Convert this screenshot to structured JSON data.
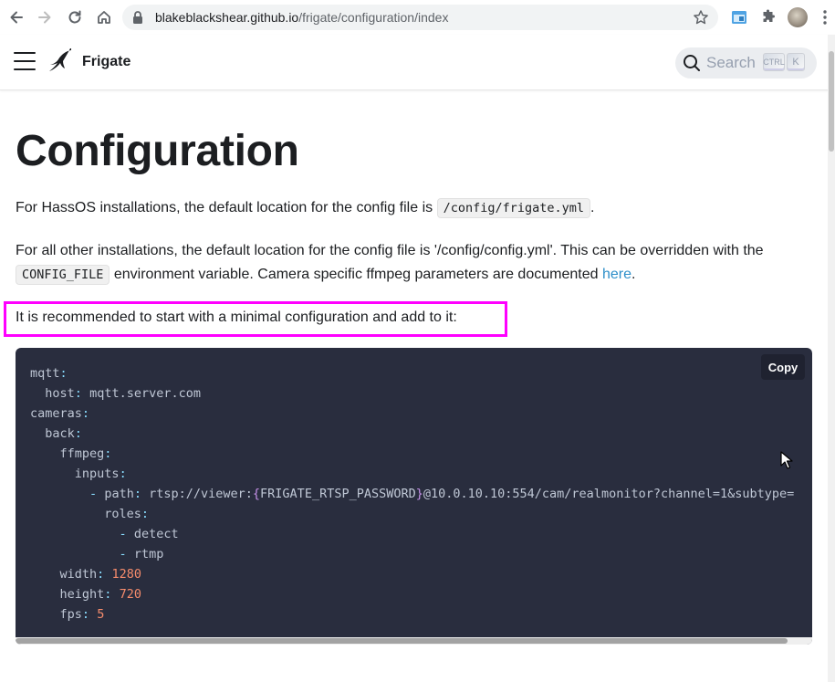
{
  "browser": {
    "url_host": "blakeblackshear.github.io",
    "url_path": "/frigate/configuration/index"
  },
  "navbar": {
    "brand": "Frigate",
    "search_placeholder": "Search",
    "kbd_ctrl": "CTRL",
    "kbd_k": "K"
  },
  "page": {
    "title": "Configuration",
    "p1_text": "For HassOS installations, the default location for the config file is ",
    "p1_code": "/config/frigate.yml",
    "p1_end": ".",
    "p2_text": "For all other installations, the default location for the config file is '/config/config.yml'. This can be overridden with the ",
    "p2_code": "CONFIG_FILE",
    "p2_text2": " environment variable. Camera specific ffmpeg parameters are documented ",
    "p2_link": "here",
    "p2_end": ".",
    "p3_text": "It is recommended to start with a minimal configuration and add to it:"
  },
  "code": {
    "copy_label": "Copy",
    "mqtt": "mqtt",
    "host_key": "host",
    "host_val": "mqtt.server.com",
    "cameras": "cameras",
    "back": "back",
    "ffmpeg": "ffmpeg",
    "inputs": "inputs",
    "path_key": "path",
    "path_val_1": "rtsp://viewer:",
    "path_var": "FRIGATE_RTSP_PASSWORD",
    "path_val_2": "@10.0.10.10:554/cam/realmonitor?channel=1&subtype=",
    "roles": "roles",
    "role_1": "detect",
    "role_2": "rtmp",
    "width_key": "width",
    "width_val": "1280",
    "height_key": "height",
    "height_val": "720",
    "fps_key": "fps",
    "fps_val": "5"
  }
}
